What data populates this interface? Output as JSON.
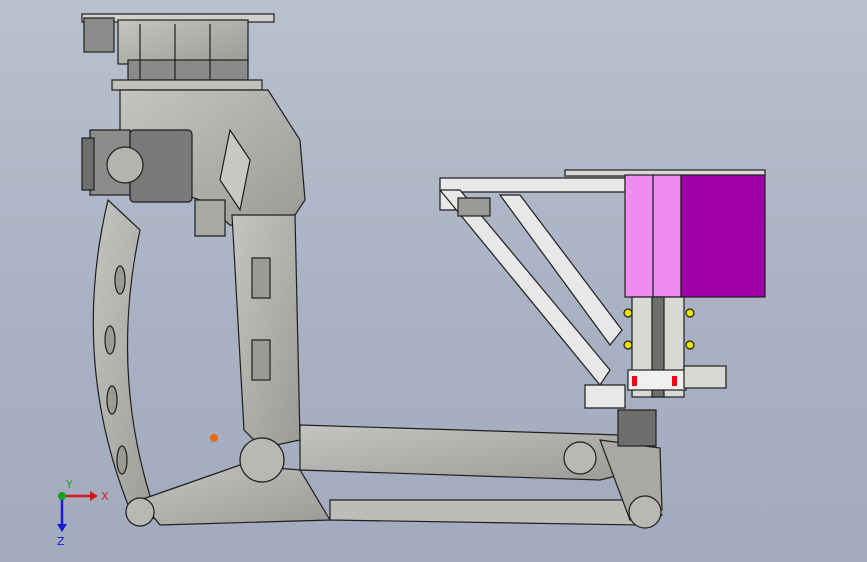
{
  "viewport": {
    "background_top": "#b9c1cf",
    "background_bottom": "#a2abbd"
  },
  "colors": {
    "robot_body": "#a8a8a4",
    "robot_dark": "#6e6e6c",
    "outline": "#1e1e1e",
    "frame": "#e8e8e8",
    "magenta_light": "#f08cf0",
    "magenta_dark": "#a100a8",
    "accent_yellow": "#e8e000",
    "accent_red": "#e01010",
    "accent_orange": "#e86a10"
  },
  "triad": {
    "x_label": "X",
    "y_label": "Y",
    "z_label": "Z",
    "x_color": "#d81818",
    "y_color": "#18a018",
    "z_color": "#1818d8"
  }
}
